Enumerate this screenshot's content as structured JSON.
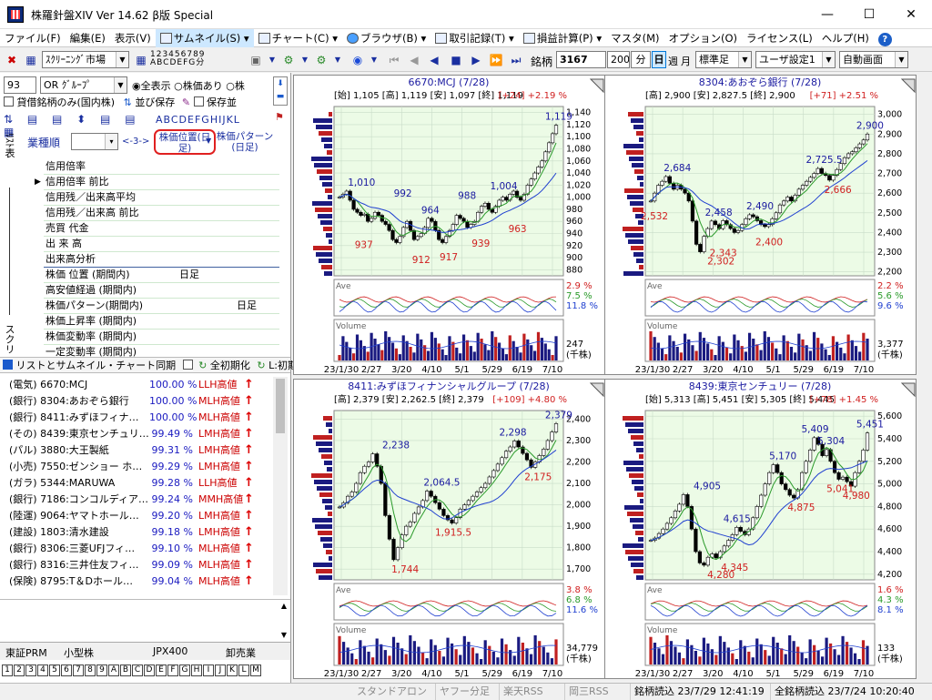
{
  "app": {
    "title": "株羅針盤XIV Ver 14.62 β版  Special"
  },
  "window_buttons": {
    "minimize": "—",
    "maximize": "☐",
    "close": "✕"
  },
  "menu": [
    "ファイル(F)",
    "編集(E)",
    "表示(V)",
    "サムネイル(S)",
    "チャート(C)",
    "ブラウザ(B)",
    "取引記録(T)",
    "損益計算(P)",
    "マスタ(M)",
    "オプション(O)",
    "ライセンス(L)",
    "ヘルプ(H)",
    "?"
  ],
  "toolbar": {
    "screening": "ｽｸﾘｰﾆﾝｸﾞ市場",
    "num_top": "123456789",
    "num_bottom": "ABCDEFG分",
    "code_label": "銘柄",
    "code_value": "3167",
    "period": "200",
    "unit": "分",
    "day": "日",
    "week": "週",
    "month": "月",
    "std": "標準足",
    "user": "ユーザ設定1",
    "auto": "自動画面"
  },
  "left": {
    "num": "93",
    "group": "OR ｸﾞﾙｰﾌﾟ",
    "radio_all": "全表示",
    "radio_price": "株価あり",
    "radio_more": "株",
    "check_lend": "貸借銘柄のみ(国内株)",
    "sort_save": "並び保存",
    "check_save": "保存並",
    "letters": "ABCDEFGHIJKL",
    "side_top": "ﾘｽﾄ表",
    "side_mid": "ﾘﾝﾀﾞｰ",
    "side_bottom": "スクリ",
    "industry": "業種順",
    "range": "<-3->",
    "col1": "株価位置(日足)",
    "col2": "株価パターン(日足)",
    "rows": [
      "信用倍率",
      "信用倍率 前比",
      "信用残／出来高平均",
      "信用残／出来高 前比",
      "売買 代金",
      "出 来 高",
      "出来高分析",
      "株価 位置 (期間内)",
      "高安値経過 (期間内)",
      "株価パターン(期間内)",
      "株価上昇率 (期間内)",
      "株価変動率 (期間内)",
      "一定変動率 (期間内)"
    ],
    "row_vals": {
      "7": "日足",
      "9": "日足"
    },
    "sync": "リストとサムネイル・チャート同期",
    "all_init": "全初期化",
    "l_init": "L:初期値",
    "stocks": [
      {
        "name": "(電気) 6670:MCJ",
        "pct": "100.00 %",
        "tag": "LLH高値"
      },
      {
        "name": "(銀行) 8304:あおぞら銀行",
        "pct": "100.00 %",
        "tag": "MLH高値"
      },
      {
        "name": "(銀行) 8411:みずほフィナ…",
        "pct": "100.00 %",
        "tag": "MLH高値"
      },
      {
        "name": "(その) 8439:東京センチュリ…",
        "pct": "99.49 %",
        "tag": "LMH高値"
      },
      {
        "name": "(パル) 3880:大王製紙",
        "pct": "99.31 %",
        "tag": "LMH高値"
      },
      {
        "name": "(小売) 7550:ゼンショー ホ…",
        "pct": "99.29 %",
        "tag": "LMH高値"
      },
      {
        "name": "(ガラ) 5344:MARUWA",
        "pct": "99.28 %",
        "tag": "LLH高値"
      },
      {
        "name": "(銀行) 7186:コンコルディア…",
        "pct": "99.24 %",
        "tag": "MMH高値"
      },
      {
        "name": "(陸運) 9064:ヤマトホール…",
        "pct": "99.20 %",
        "tag": "LMH高値"
      },
      {
        "name": "(建設) 1803:清水建設",
        "pct": "99.18 %",
        "tag": "LMH高値"
      },
      {
        "name": "(銀行) 8306:三菱UFJフィ…",
        "pct": "99.10 %",
        "tag": "MLH高値"
      },
      {
        "name": "(銀行) 8316:三井住友フィ…",
        "pct": "99.09 %",
        "tag": "MLH高値"
      },
      {
        "name": "(保険) 8795:T＆Dホール…",
        "pct": "99.04 %",
        "tag": "MLH高値"
      }
    ],
    "tabs": [
      "東証PRM",
      "小型株",
      "JPX400",
      "卸売業"
    ],
    "keys": "123456789ABCDEFGHIJKLM"
  },
  "status": [
    "スタンドアロン",
    "ヤフー分足",
    "楽天RSS",
    "岡三RSS",
    "銘柄読込 23/7/29 12:41:19",
    "全銘柄読込 23/7/24 10:20:40"
  ],
  "charts": [
    {
      "title": "6670:MCJ (7/28)",
      "ohlc_text": "[始] 1,105 [高] 1,119 [安] 1,097 [終] 1,119",
      "change": "[+24] +2.19 %",
      "yticks": [
        "1,140",
        "1,120",
        "1,100",
        "1,080",
        "1,060",
        "1,040",
        "1,020",
        "1,000",
        "980",
        "960",
        "940",
        "920",
        "900",
        "880"
      ],
      "xticks": [
        "23/1/30",
        "2/27",
        "3/20",
        "4/10",
        "5/1",
        "5/29",
        "6/19",
        "7/10"
      ],
      "ave": [
        "2.9 %",
        "7.5 %",
        "11.8 %"
      ],
      "vol": "247",
      "vol_unit": "(千株)",
      "ymin": 870,
      "ymax": 1150,
      "highs": [
        [
          "1,010",
          0.12,
          1010
        ],
        [
          "992",
          0.3,
          992
        ],
        [
          "964",
          0.42,
          964
        ],
        [
          "988",
          0.58,
          988
        ],
        [
          "1,004",
          0.74,
          1004
        ],
        [
          "1,119",
          0.98,
          1119
        ]
      ],
      "lows": [
        [
          "937",
          0.13,
          937
        ],
        [
          "912",
          0.38,
          912
        ],
        [
          "917",
          0.5,
          917
        ],
        [
          "939",
          0.64,
          939
        ],
        [
          "963",
          0.8,
          963
        ]
      ],
      "path": [
        1000,
        1005,
        1010,
        995,
        980,
        975,
        970,
        972,
        960,
        965,
        975,
        970,
        960,
        955,
        945,
        930,
        925,
        935,
        950,
        960,
        945,
        930,
        935,
        940,
        950,
        965,
        960,
        945,
        930,
        925,
        935,
        945,
        955,
        970,
        965,
        960,
        950,
        955,
        960,
        975,
        985,
        990,
        980,
        975,
        985,
        995,
        1000,
        995,
        1005,
        1010,
        1000,
        995,
        1005,
        1020,
        1030,
        1040,
        1050,
        1060,
        1075,
        1090,
        1105,
        1119
      ]
    },
    {
      "title": "8304:あおぞら銀行 (7/28)",
      "ohlc_text": "[高] 2,900 [安] 2,827.5 [終] 2,900",
      "change": "[+71] +2.51 %",
      "yticks": [
        "3,000",
        "2,900",
        "2,800",
        "2,700",
        "2,600",
        "2,500",
        "2,400",
        "2,300",
        "2,200"
      ],
      "xticks": [
        "23/1/30",
        "2/27",
        "3/20",
        "4/10",
        "5/1",
        "5/29",
        "6/19",
        "7/10"
      ],
      "ave": [
        "2.2 %",
        "5.6 %",
        "9.6 %"
      ],
      "vol": "3,377",
      "vol_unit": "(千株)",
      "ymin": 2180,
      "ymax": 3040,
      "highs": [
        [
          "2,684",
          0.14,
          2684
        ],
        [
          "2,458",
          0.32,
          2458
        ],
        [
          "2,490",
          0.5,
          2490
        ],
        [
          "2,725.5",
          0.78,
          2725
        ],
        [
          "2,900",
          0.98,
          2900
        ]
      ],
      "lows": [
        [
          "2,532",
          0.04,
          2532
        ],
        [
          "2,343",
          0.34,
          2343
        ],
        [
          "2,302",
          0.33,
          2302
        ],
        [
          "2,400",
          0.54,
          2400
        ],
        [
          "2,666",
          0.84,
          2666
        ]
      ],
      "path": [
        2560,
        2600,
        2640,
        2660,
        2684,
        2650,
        2620,
        2640,
        2620,
        2600,
        2560,
        2458,
        2340,
        2302,
        2380,
        2420,
        2458,
        2440,
        2420,
        2460,
        2440,
        2420,
        2400,
        2410,
        2440,
        2470,
        2490,
        2480,
        2460,
        2440,
        2430,
        2440,
        2470,
        2500,
        2540,
        2560,
        2580,
        2560,
        2590,
        2620,
        2640,
        2660,
        2680,
        2700,
        2725,
        2700,
        2690,
        2666,
        2690,
        2720,
        2750,
        2780,
        2800,
        2810,
        2830,
        2850,
        2870,
        2900
      ]
    },
    {
      "title": "8411:みずほフィナンシャルグループ (7/28)",
      "ohlc_text": "[高] 2,379 [安] 2,262.5 [終] 2,379",
      "change": "[+109] +4.80 %",
      "yticks": [
        "2,400",
        "2,300",
        "2,200",
        "2,100",
        "2,000",
        "1,900",
        "1,800",
        "1,700"
      ],
      "xticks": [
        "23/1/30",
        "2/27",
        "3/20",
        "4/10",
        "5/1",
        "5/29",
        "6/19",
        "7/10"
      ],
      "ave": [
        "3.8 %",
        "6.8 %",
        "11.6 %"
      ],
      "vol": "34,779",
      "vol_unit": "(千株)",
      "ymin": 1650,
      "ymax": 2440,
      "highs": [
        [
          "2,238",
          0.27,
          2238
        ],
        [
          "2,064.5",
          0.47,
          2064
        ],
        [
          "2,298",
          0.78,
          2298
        ],
        [
          "2,379",
          0.98,
          2379
        ]
      ],
      "lows": [
        [
          "1,744",
          0.31,
          1744
        ],
        [
          "1,915.5",
          0.52,
          1915
        ],
        [
          "2,175",
          0.89,
          2175
        ]
      ],
      "path": [
        1990,
        2010,
        2040,
        2060,
        2100,
        2150,
        2180,
        2200,
        2238,
        2180,
        2100,
        1950,
        1840,
        1744,
        1800,
        1860,
        1900,
        1920,
        1960,
        1990,
        2020,
        2064,
        2040,
        2010,
        1980,
        1950,
        1930,
        1915,
        1940,
        1980,
        2000,
        2020,
        2040,
        2060,
        2080,
        2100,
        2130,
        2160,
        2190,
        2220,
        2250,
        2270,
        2298,
        2270,
        2240,
        2210,
        2175,
        2200,
        2230,
        2260,
        2300,
        2340,
        2379
      ]
    },
    {
      "title": "8439:東京センチュリー (7/28)",
      "ohlc_text": "[始] 5,313 [高] 5,451 [安] 5,305 [終] 5,445",
      "change": "[+78] +1.45 %",
      "yticks": [
        "5,600",
        "5,400",
        "5,200",
        "5,000",
        "4,800",
        "4,600",
        "4,400",
        "4,200"
      ],
      "xticks": [
        "23/1/30",
        "2/27",
        "3/20",
        "4/10",
        "5/1",
        "5/29",
        "6/19",
        "7/10"
      ],
      "ave": [
        "1.6 %",
        "4.3 %",
        "8.1 %"
      ],
      "vol": "133",
      "vol_unit": "(千株)",
      "ymin": 4150,
      "ymax": 5650,
      "highs": [
        [
          "4,905",
          0.27,
          4905
        ],
        [
          "4,615",
          0.4,
          4615
        ],
        [
          "5,170",
          0.6,
          5170
        ],
        [
          "5,409",
          0.74,
          5409
        ],
        [
          "5,304",
          0.81,
          5304
        ],
        [
          "5,451",
          0.98,
          5451
        ]
      ],
      "lows": [
        [
          "4,280",
          0.33,
          4280
        ],
        [
          "4,345",
          0.39,
          4345
        ],
        [
          "4,875",
          0.68,
          4875
        ],
        [
          "5,041",
          0.85,
          5041
        ],
        [
          "4,980",
          0.92,
          4980
        ]
      ],
      "path": [
        4500,
        4520,
        4560,
        4600,
        4650,
        4700,
        4760,
        4820,
        4905,
        4800,
        4600,
        4400,
        4300,
        4280,
        4350,
        4380,
        4345,
        4400,
        4450,
        4500,
        4550,
        4615,
        4580,
        4550,
        4600,
        4700,
        4800,
        4900,
        5000,
        5100,
        5170,
        5100,
        5000,
        4950,
        4900,
        4875,
        4950,
        5100,
        5200,
        5300,
        5409,
        5350,
        5250,
        5304,
        5200,
        5100,
        5041,
        5060,
        5020,
        4980,
        5100,
        5200,
        5300,
        5451
      ]
    }
  ]
}
